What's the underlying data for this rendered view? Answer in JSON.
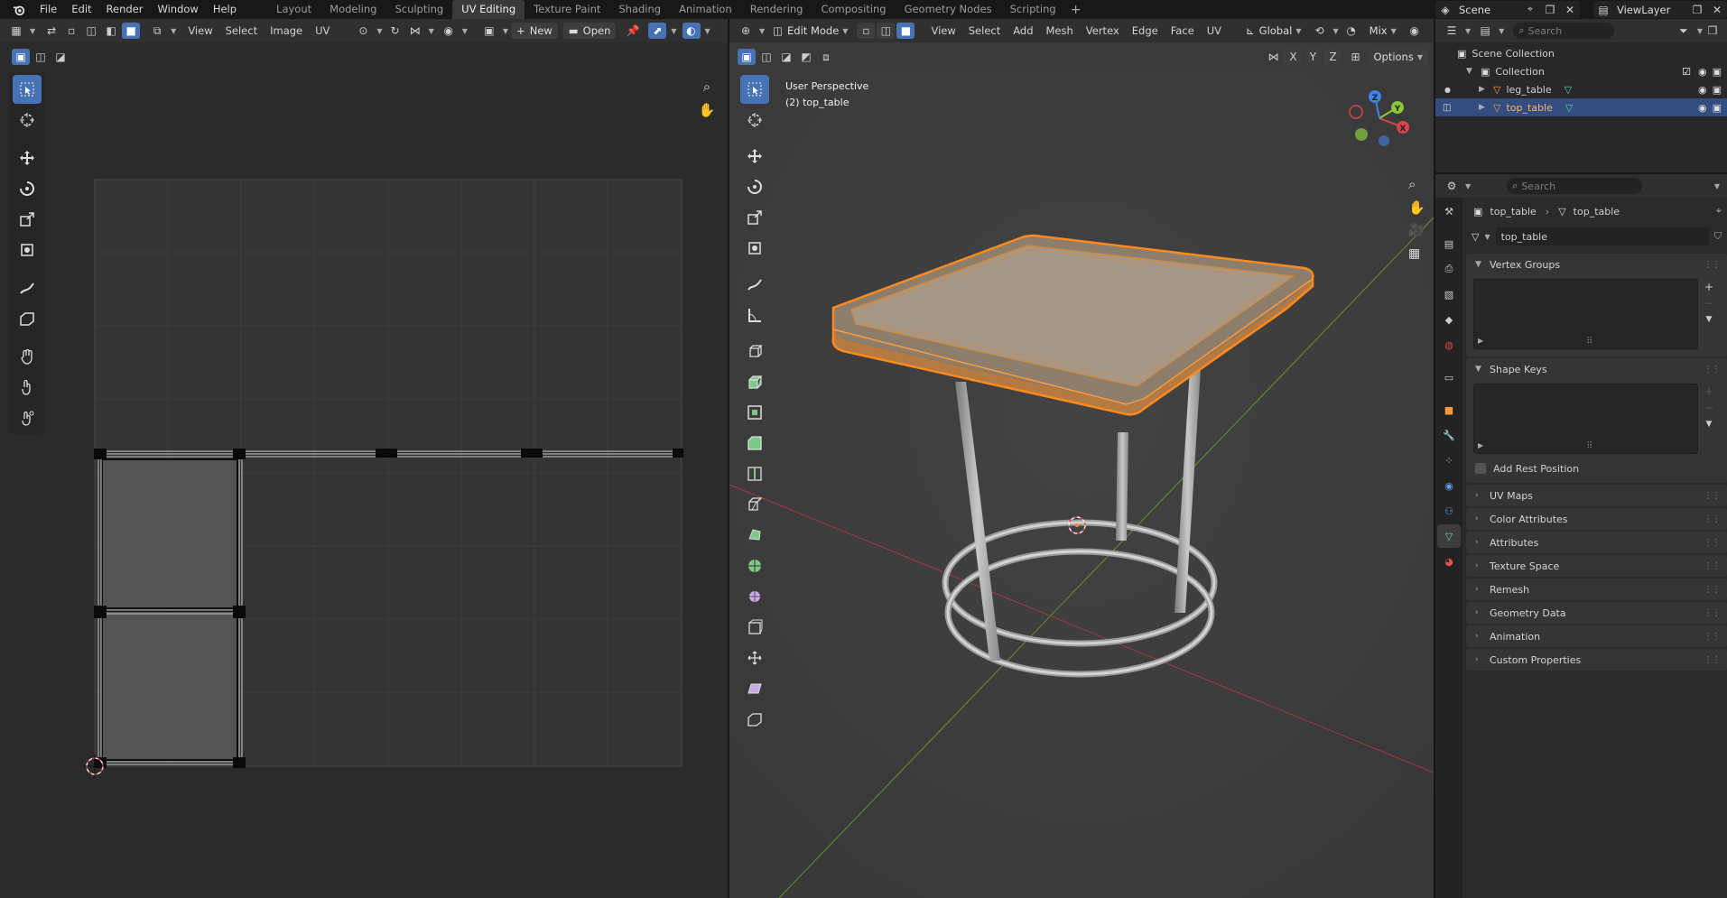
{
  "topbar": {
    "menus": [
      "File",
      "Edit",
      "Render",
      "Window",
      "Help"
    ],
    "workspaces": [
      "Layout",
      "Modeling",
      "Sculpting",
      "UV Editing",
      "Texture Paint",
      "Shading",
      "Animation",
      "Rendering",
      "Compositing",
      "Geometry Nodes",
      "Scripting"
    ],
    "active_workspace": "UV Editing",
    "scene": "Scene",
    "view_layer": "ViewLayer"
  },
  "uv_editor": {
    "menus": [
      "View",
      "Select",
      "Image",
      "UV"
    ],
    "new_label": "New",
    "open_label": "Open"
  },
  "viewport": {
    "mode": "Edit Mode",
    "menus": [
      "View",
      "Select",
      "Add",
      "Mesh",
      "Vertex",
      "Edge",
      "Face",
      "UV"
    ],
    "orientation": "Global",
    "snap_mode": "Mix",
    "options_label": "Options",
    "overlay_line1": "User Perspective",
    "overlay_line2": "(2) top_table",
    "axes": [
      "X",
      "Y",
      "Z"
    ],
    "gizmo_labels": [
      "X",
      "Y",
      "Z"
    ]
  },
  "outliner": {
    "search_placeholder": "Search",
    "root": "Scene Collection",
    "collection": "Collection",
    "items": [
      {
        "name": "leg_table",
        "selected": false
      },
      {
        "name": "top_table",
        "selected": true
      }
    ]
  },
  "properties": {
    "search_placeholder": "Search",
    "breadcrumb_object": "top_table",
    "breadcrumb_mesh": "top_table",
    "mesh_name": "top_table",
    "panels": {
      "vertex_groups": "Vertex Groups",
      "shape_keys": "Shape Keys",
      "add_rest_position": "Add Rest Position",
      "collapsed": [
        "UV Maps",
        "Color Attributes",
        "Attributes",
        "Texture Space",
        "Remesh",
        "Geometry Data",
        "Animation",
        "Custom Properties"
      ]
    }
  },
  "colors": {
    "accent": "#4772b3",
    "selection_orange": "#ff8a1f",
    "x_axis": "#d9434b",
    "y_axis": "#8cc83c",
    "z_axis": "#3f83e8"
  }
}
